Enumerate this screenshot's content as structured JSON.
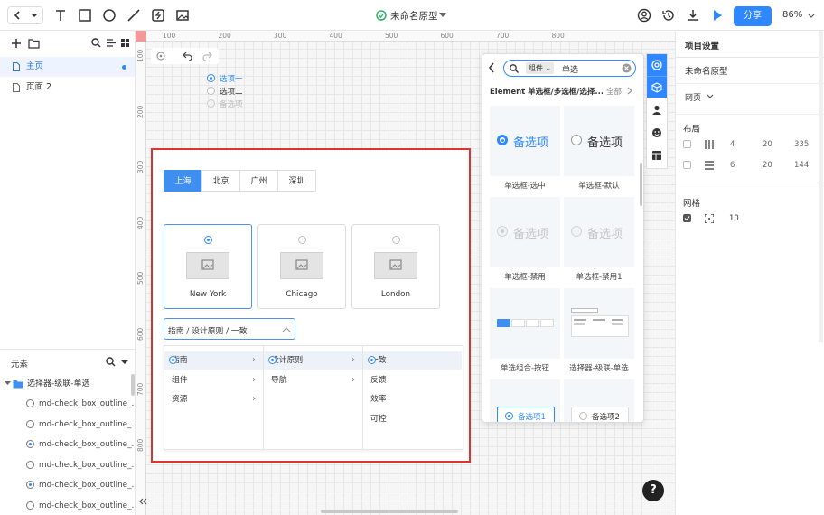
{
  "toolbar": {
    "doc_title": "未命名原型",
    "share_label": "分享",
    "zoom": "86%"
  },
  "left_panel": {
    "pages": [
      {
        "label": "主页",
        "active": true
      },
      {
        "label": "页面 2",
        "active": false
      }
    ],
    "elements_title": "元素",
    "elements_group": "选择器-级联-单选",
    "elements": [
      {
        "label": "md-check_box_outline_...",
        "checked": false
      },
      {
        "label": "md-check_box_outline_...",
        "checked": false
      },
      {
        "label": "md-check_box_outline_...",
        "checked": true
      },
      {
        "label": "md-check_box_outline_...",
        "checked": false
      },
      {
        "label": "md-check_box_outline_...",
        "checked": true
      },
      {
        "label": "md-check_box_outline_...",
        "checked": false
      }
    ]
  },
  "rulers": {
    "top": [
      "100",
      "200",
      "300",
      "400",
      "500",
      "600",
      "700",
      "800"
    ],
    "left": [
      "100",
      "200",
      "300",
      "400",
      "500",
      "600",
      "700",
      "800"
    ]
  },
  "canvas_radio_group": {
    "items": [
      {
        "label": "选项一",
        "state": "selected"
      },
      {
        "label": "选项二",
        "state": "normal"
      },
      {
        "label": "备选项",
        "state": "disabled"
      }
    ]
  },
  "prototype": {
    "tabs": [
      {
        "label": "上海",
        "active": true
      },
      {
        "label": "北京",
        "active": false
      },
      {
        "label": "广州",
        "active": false
      },
      {
        "label": "深圳",
        "active": false
      }
    ],
    "cities": [
      {
        "label": "New York",
        "selected": true
      },
      {
        "label": "Chicago",
        "selected": false
      },
      {
        "label": "London",
        "selected": false
      }
    ],
    "cascader_value": "指南 / 设计原则 / 一致",
    "cascader_columns": [
      [
        {
          "label": "指南",
          "has_children": true,
          "highlight": true
        },
        {
          "label": "组件",
          "has_children": true,
          "highlight": false
        },
        {
          "label": "资源",
          "has_children": true,
          "highlight": false
        }
      ],
      [
        {
          "label": "设计原则",
          "has_children": true,
          "highlight": true
        },
        {
          "label": "导航",
          "has_children": true,
          "highlight": false
        }
      ],
      [
        {
          "label": "一致",
          "has_children": false,
          "highlight": true
        },
        {
          "label": "反馈",
          "has_children": false,
          "highlight": false
        },
        {
          "label": "效率",
          "has_children": false,
          "highlight": false
        },
        {
          "label": "可控",
          "has_children": false,
          "highlight": false
        }
      ]
    ]
  },
  "library": {
    "search_tag": "组件",
    "search_value": "单选",
    "category": "Element 单选框/多选框/选择...",
    "all_label": "全部",
    "cards": [
      {
        "preview": "备选项",
        "label": "单选框-选中",
        "state": "selected"
      },
      {
        "preview": "备选项",
        "label": "单选框-默认",
        "state": "normal"
      },
      {
        "preview": "备选项",
        "label": "单选框-禁用",
        "state": "disabled"
      },
      {
        "preview": "备选项",
        "label": "单选框-禁用1",
        "state": "disabled2"
      },
      {
        "preview": "",
        "label": "单选组合-按钮",
        "state": "buttons"
      },
      {
        "preview": "",
        "label": "选择器-级联-单选",
        "state": "cascader"
      },
      {
        "preview": "备选项1",
        "label": "",
        "state": "bordered-selected"
      },
      {
        "preview": "备选项2",
        "label": "",
        "state": "bordered"
      }
    ]
  },
  "right_panel": {
    "title": "项目设置",
    "project_name": "未命名原型",
    "device": "网页",
    "layout_title": "布局",
    "layout_rows": [
      {
        "a": "4",
        "b": "20",
        "c": "335"
      },
      {
        "a": "6",
        "b": "20",
        "c": "144"
      }
    ],
    "grid_title": "网格",
    "grid_value": "10"
  },
  "colors": {
    "accent": "#2f88ff",
    "highlight_border": "#e0322f",
    "status_green": "#2fb36b"
  }
}
